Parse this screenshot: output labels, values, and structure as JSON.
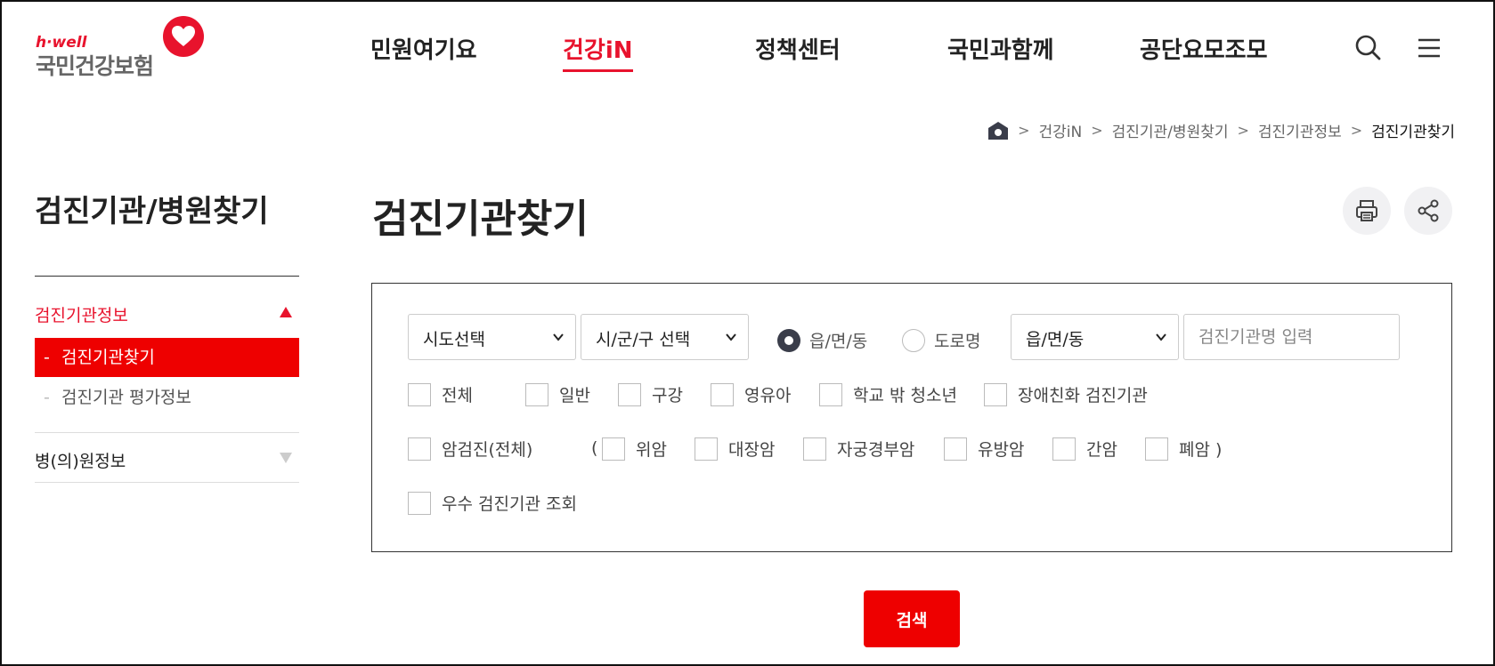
{
  "logo": {
    "tagline": "h·well",
    "name": "국민건강보험"
  },
  "gnb": {
    "items": [
      {
        "label": "민원여기요",
        "active": false
      },
      {
        "label": "건강iN",
        "active": true
      },
      {
        "label": "정책센터",
        "active": false
      },
      {
        "label": "국민과함께",
        "active": false
      },
      {
        "label": "공단요모조모",
        "active": false
      }
    ],
    "icons": [
      "search-icon",
      "menu-icon"
    ]
  },
  "breadcrumb": {
    "items": [
      "건강iN",
      "검진기관/병원찾기",
      "검진기관정보"
    ],
    "current": "검진기관찾기",
    "separator": ">"
  },
  "sidebar": {
    "title": "검진기관/병원찾기",
    "sections": [
      {
        "label": "검진기관정보",
        "expanded": true,
        "items": [
          {
            "label": "검진기관찾기",
            "active": true
          },
          {
            "label": "검진기관 평가정보",
            "active": false
          }
        ]
      },
      {
        "label": "병(의)원정보",
        "expanded": false,
        "items": []
      }
    ]
  },
  "main": {
    "title": "검진기관찾기",
    "tools": [
      "print-icon",
      "share-icon"
    ]
  },
  "search": {
    "sido": "시도선택",
    "sigungu": "시/군/구 선택",
    "addr_type": {
      "options": [
        "읍/면/동",
        "도로명"
      ],
      "selected": "읍/면/동"
    },
    "dong": "읍/면/동",
    "name_placeholder": "검진기관명 입력",
    "row1": [
      "전체",
      "일반",
      "구강",
      "영유아",
      "학교 밖 청소년",
      "장애친화 검진기관"
    ],
    "cancer_all": "암검진(전체)",
    "paren_open": "(",
    "cancer": [
      "위암",
      "대장암",
      "자궁경부암",
      "유방암",
      "간암",
      "폐암 )"
    ],
    "excellent": "우수 검진기관 조회",
    "submit": "검색"
  },
  "colors": {
    "accent": "#ee0000",
    "brand": "#e8132d",
    "radio": "#3a3d4a"
  }
}
